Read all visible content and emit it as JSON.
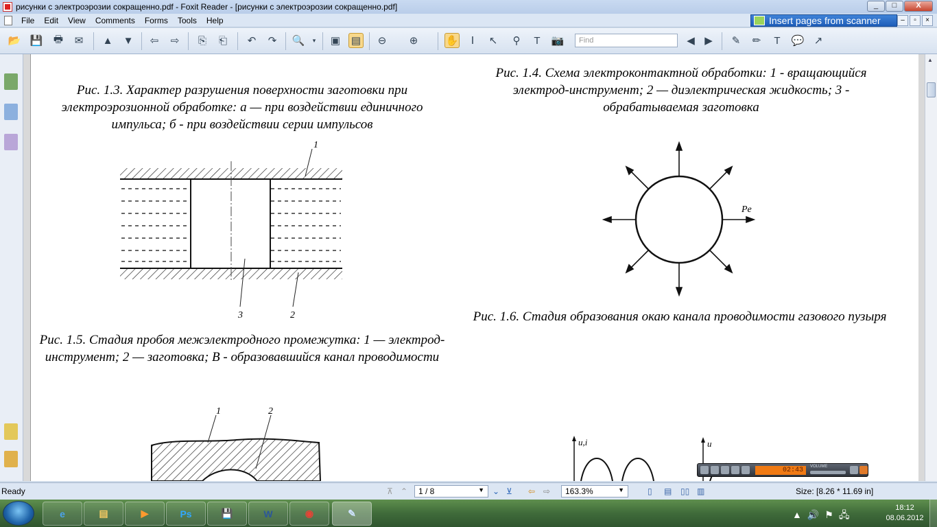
{
  "window": {
    "title": "рисунки с электроэрозии сокращенно.pdf - Foxit Reader - [рисунки с электроэрозии сокращенно.pdf]",
    "minimize": "_",
    "maximize": "□",
    "close": "X"
  },
  "menu": {
    "items": [
      "File",
      "Edit",
      "View",
      "Comments",
      "Forms",
      "Tools",
      "Help"
    ],
    "insert_pages": "Insert pages from scanner"
  },
  "toolbar": {
    "find_placeholder": "Find",
    "icons": [
      "open-icon",
      "save-icon",
      "print-icon",
      "email-icon",
      "up-icon",
      "down-icon",
      "back-icon",
      "forward-icon",
      "extract-icon",
      "insert-icon",
      "undo-icon",
      "redo-icon",
      "zoom-icon",
      "fit-page-icon",
      "fit-width-icon",
      "zoom-out-icon",
      "zoom-in-icon",
      "hand-tool-icon",
      "select-text-icon",
      "select-icon",
      "find-icon",
      "typewriter-icon",
      "snapshot-icon",
      "prev-result-icon",
      "next-result-icon",
      "note-icon",
      "pencil-icon",
      "textbox-icon",
      "comment-icon",
      "arrow-icon"
    ]
  },
  "document": {
    "caption_1_3": "Рис. 1.3. Характер разрушения поверхности заготовки при электроэрозионной обработке: а — при воздействии единичного импульса; б - при воздействии серии импульсов",
    "caption_1_4": "Рис. 1.4. Схема электроконтактной обработки: 1 - вращающийся электрод-инструмент; 2 — диэлектрическая жидкость; 3 - обрабатываемая заготовка",
    "caption_1_5": "Рис. 1.5. Стадия пробоя межэлектродного промежутка: 1 — электрод-инструмент; 2 — заготовка; В - образовавшийся канал проводимости",
    "caption_1_6": "Рис. 1.6. Стадия образования окаю канала проводимости газового пузыря",
    "fig_labels": {
      "one": "1",
      "two": "2",
      "three": "3",
      "pe": "Pe",
      "ui": "u,i",
      "u": "u"
    }
  },
  "status": {
    "ready": "Ready",
    "page": "1 / 8",
    "zoom": "163.3%",
    "size": "Size: [8.26 * 11.69 in]"
  },
  "player": {
    "time": "02:43",
    "volume": "VOLUME"
  },
  "taskbar": {
    "apps": [
      "ie-icon",
      "explorer-icon",
      "media-icon",
      "Ps",
      "save-icon",
      "W",
      "chrome-icon",
      "foxit-icon"
    ],
    "time": "18:12",
    "date": "08.06.2012"
  }
}
